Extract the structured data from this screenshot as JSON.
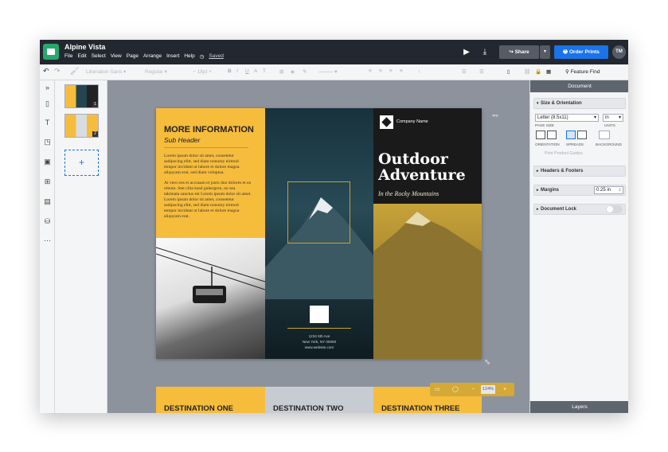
{
  "app": {
    "title": "Alpine Vista",
    "saved": "Saved"
  },
  "menu": [
    "File",
    "Edit",
    "Select",
    "View",
    "Page",
    "Arrange",
    "Insert",
    "Help"
  ],
  "topbar": {
    "share": "Share",
    "order": "Order Prints",
    "avatar": "TM"
  },
  "toolbar": {
    "font": "Liberation Sans",
    "weight": "Regular",
    "size": "18pt",
    "feature_find": "Feature Find"
  },
  "pages": {
    "thumb1_num": "1",
    "thumb2_num": "2"
  },
  "brochure": {
    "info_heading": "MORE INFORMATION",
    "info_sub": "Sub Header",
    "para1": "Lorem ipsum dolor sit amet, consetetur sadipscing elitr, sed diam nonumy eirmod tempor invidunt ut labore et dolore magna aliquyam erat, sed diam voluptua.",
    "para2": "At vero eos et accusam et justo duo dolores et ea rebum. Stet clita kasd gubergren, no sea takimata sanctus est Lorem ipsum dolor sit amet. Lorem ipsum dolor sit amet, consetetur sadipscing elitr, sed diam nonumy eirmod tempor invidunt ut labore et dolore magna aliquyam erat.",
    "company": "Company Name",
    "title_line1": "Outdoor",
    "title_line2": "Adventure",
    "tagline": "In the Rocky Mountains",
    "addr1": "1234 5th Ave",
    "addr2": "New York, NY 00000",
    "addr3": "www.website.com"
  },
  "page2": {
    "dest1": "DESTINATION ONE",
    "dest2": "DESTINATION TWO",
    "dest3": "DESTINATION THREE"
  },
  "zoom": "124%",
  "panel": {
    "header": "Document",
    "size_section": "Size & Orientation",
    "page_size_value": "Letter (8.5x11)",
    "page_size_label": "PAGE SIZE",
    "units_value": "in",
    "units_label": "UNITS",
    "orientation_label": "ORIENTATION",
    "spreads_label": "SPREADS",
    "background_label": "BACKGROUND",
    "print_guides": "Print Product Guides",
    "headers_footers": "Headers & Footers",
    "margins": "Margins",
    "margins_value": "0.25 in",
    "doc_lock": "Document Lock",
    "layers": "Layers"
  }
}
